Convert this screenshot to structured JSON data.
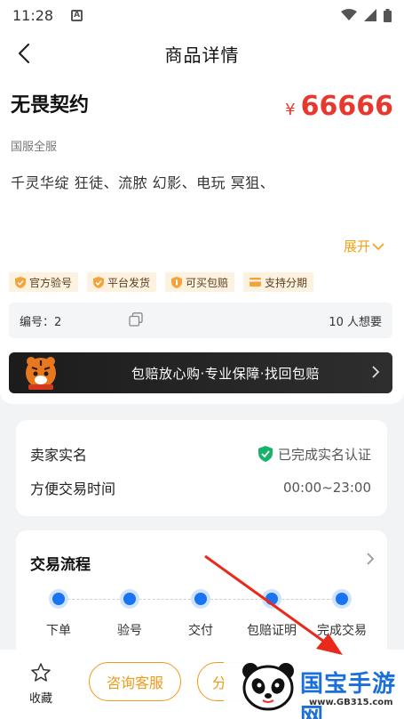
{
  "status_bar": {
    "time": "11:28",
    "a_badge": "A"
  },
  "nav": {
    "title": "商品详情"
  },
  "product": {
    "title": "无畏契约",
    "currency": "¥",
    "price": "66666",
    "server": "国服全服",
    "description": "千灵华绽 狂徒、流脓 幻影、电玩 冥狙、",
    "expand_label": "展开"
  },
  "tags": [
    {
      "label": "官方验号",
      "icon": "shield-check-icon"
    },
    {
      "label": "平台发货",
      "icon": "shield-check-icon"
    },
    {
      "label": "可买包赔",
      "icon": "shield-icon"
    },
    {
      "label": "支持分期",
      "icon": "card-icon"
    }
  ],
  "info": {
    "code_label": "编号：2",
    "want_label": "10 人想要"
  },
  "banner": {
    "text": "包赔放心购·专业保障·找回包赔"
  },
  "seller": {
    "rows": [
      {
        "label": "卖家实名",
        "value": "已完成实名认证"
      },
      {
        "label": "方便交易时间",
        "value": "00:00~23:00"
      }
    ]
  },
  "flow": {
    "title": "交易流程",
    "steps": [
      "下单",
      "验号",
      "交付",
      "包赔证明",
      "完成交易"
    ]
  },
  "bottom": {
    "favorite_label": "收藏",
    "consult_label": "咨询客服",
    "second_label": "分"
  },
  "watermark": {
    "text": "国宝手游网",
    "url": "www.GB315.com"
  },
  "colors": {
    "price": "#e8382e",
    "accent": "#f09a1a",
    "step": "#1a73f0",
    "check": "#19b26b"
  }
}
